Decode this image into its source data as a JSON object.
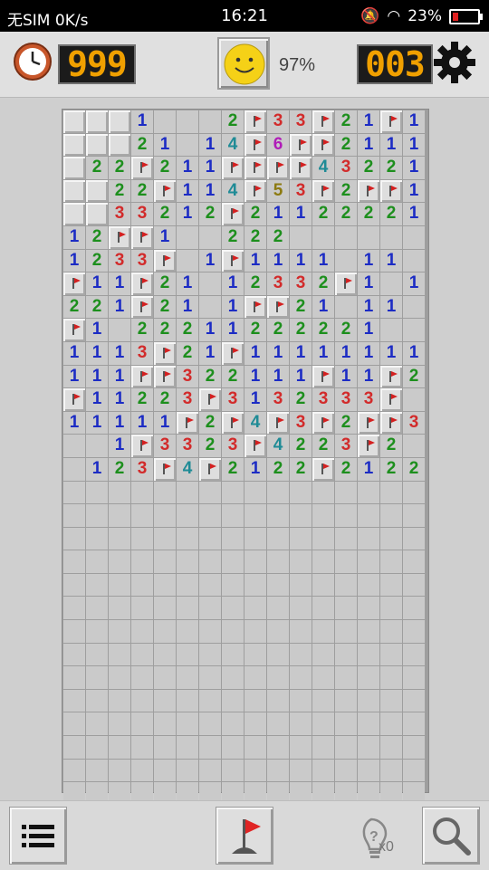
{
  "status_bar": {
    "carrier": "无SIM",
    "speed": "0K/s",
    "time": "16:21",
    "battery": "23%"
  },
  "header": {
    "timer": "999",
    "percent": "97%",
    "mines_left": "003"
  },
  "board": {
    "rows": [
      "UUU1...2F33F21F1",
      "UUU21.14F6FF2111",
      "U22F211FFFF43221",
      "UU22F114F53F2FF1",
      "UU33212F21122221",
      "12FF1..222......",
      "1233F.1F1111.11.",
      "F11F21.12332F1.1F",
      "221F21.1FF21.11.",
      "F1.22211222221...",
      "1113F21F11111111.",
      "111FF322111F11F21",
      "F11223F3132333F",
      "11111F2F4F3F2FF31",
      "..1F3323F4223F2.",
      ".123F4F2122F2122F1"
    ]
  },
  "toolbar": {
    "hint_count": "x0"
  },
  "icons": [
    "clock-icon",
    "smiley-icon",
    "gear-icon",
    "menu-icon",
    "flag-icon",
    "lightbulb-icon",
    "magnifier-icon"
  ]
}
